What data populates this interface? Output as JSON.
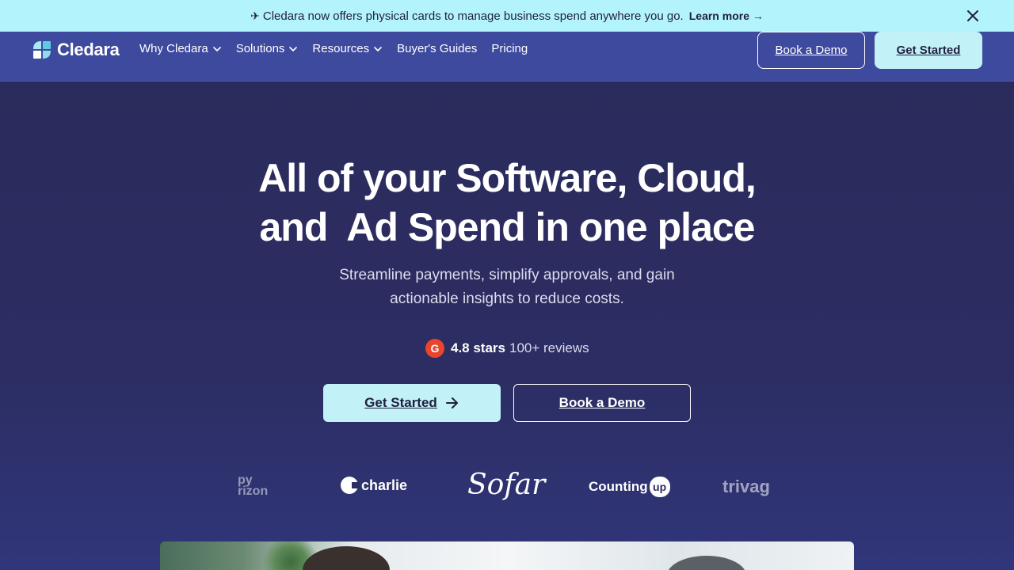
{
  "announcement": {
    "text": "Cledara now offers physical cards to manage business spend anywhere you go.",
    "link": "Learn more →"
  },
  "nav": {
    "brand": "Cledara",
    "items": [
      {
        "label": "Why Cledara",
        "has_dropdown": true
      },
      {
        "label": "Solutions",
        "has_dropdown": true
      },
      {
        "label": "Resources",
        "has_dropdown": true
      },
      {
        "label": "Buyer's Guides",
        "has_dropdown": false
      },
      {
        "label": "Pricing",
        "has_dropdown": false
      }
    ],
    "book_demo": "Book a Demo",
    "get_started": "Get Started"
  },
  "hero": {
    "headline_line1": "All of your Software, Cloud,",
    "headline_line2": "and  Ad Spend in one place",
    "sub_line1": "Streamline payments, simplify approvals, and gain",
    "sub_line2": "actionable insights to reduce costs.",
    "rating_badge": "G",
    "rating_stars": "4.8 stars",
    "rating_reviews": "100+ reviews",
    "get_started": "Get Started",
    "book_demo": "Book a Demo"
  },
  "customers": {
    "logo1_top": "py",
    "logo1_bottom": "rizon",
    "logo2": "charlie",
    "logo3": "Sofar",
    "logo4": "Counting",
    "logo4_badge": "up",
    "logo5": "trivag"
  },
  "colors": {
    "announcement_bg": "#b3f3fb",
    "nav_bg": "#3e4a9e",
    "hero_bg": "#2b2b5c",
    "accent_button": "#c2f1f7",
    "g2_red": "#e8452c"
  }
}
